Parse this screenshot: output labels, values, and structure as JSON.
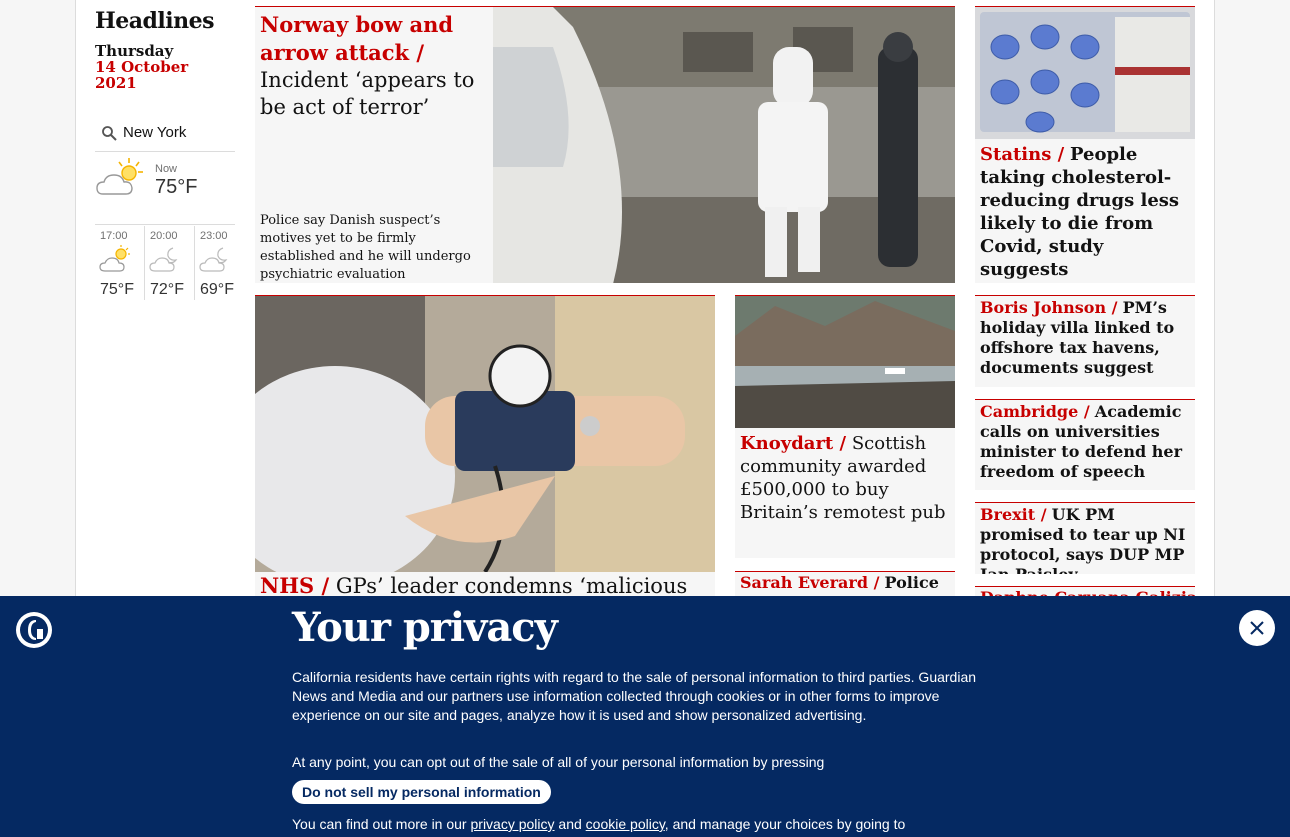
{
  "sidebar": {
    "title": "Headlines",
    "day": "Thursday",
    "date": "14 October 2021",
    "location": "New York",
    "now_label": "Now",
    "now_temp": "75°F",
    "forecast": [
      {
        "time": "17:00",
        "temp": "75°F",
        "icon": "partly-cloudy-icon"
      },
      {
        "time": "20:00",
        "temp": "72°F",
        "icon": "cloudy-moon-icon"
      },
      {
        "time": "23:00",
        "temp": "69°F",
        "icon": "cloudy-moon-icon"
      }
    ]
  },
  "hero": {
    "kicker": "Norway bow and arrow attack /",
    "headline": "Incident ‘appears to be act of terror’",
    "standfirst": "Police say Danish suspect’s motives yet to be firmly established and he will undergo psychiatric evaluation"
  },
  "statins": {
    "kicker": "Statins /",
    "headline": "People taking cholesterol-reducing drugs less likely to die from Covid, study suggests"
  },
  "johnson": {
    "kicker": "Boris Johnson /",
    "headline": "PM’s holiday villa linked to offshore tax havens, documents suggest"
  },
  "cambridge": {
    "kicker": "Cambridge /",
    "headline": "Academic calls on universities minister to defend her freedom of speech"
  },
  "brexit": {
    "kicker": "Brexit /",
    "headline": "UK PM promised to tear up NI protocol, says DUP MP Ian Paisley"
  },
  "daphne": {
    "kicker": "Daphne Caruana Galizia"
  },
  "nhs": {
    "kicker": "NHS /",
    "headline": "GPs’ leader condemns ‘malicious"
  },
  "knoydart": {
    "kicker": "Knoydart /",
    "headline": "Scottish community awarded £500,000 to buy Britain’s remotest pub"
  },
  "everard": {
    "kicker": "Sarah Everard /",
    "headline": "Police"
  },
  "privacy": {
    "title": "Your privacy",
    "p1": "California residents have certain rights with regard to the sale of personal information to third parties. Guardian News and Media and our partners use information collected through cookies or in other forms to improve experience on our site and pages, analyze how it is used and show personalized advertising.",
    "p2": "At any point, you can opt out of the sale of all of your personal information by pressing",
    "button": "Do not sell my personal information",
    "p3_start": "You can find out more in our",
    "privacy_link": "privacy policy",
    "and": "and",
    "cookie_link": "cookie policy",
    "p3_end": ", and manage your choices by going to"
  }
}
